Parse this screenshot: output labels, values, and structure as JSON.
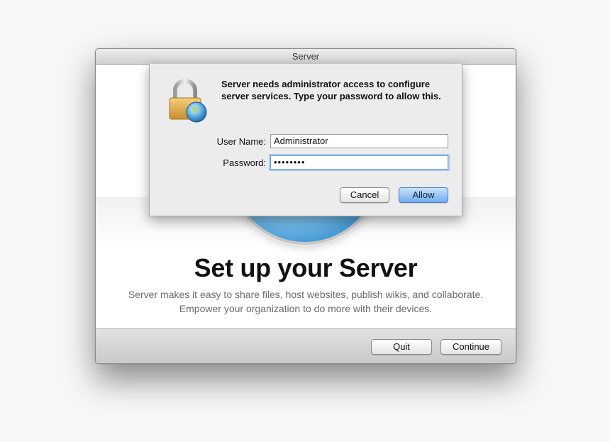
{
  "window": {
    "title": "Server"
  },
  "main": {
    "heading": "Set up your Server",
    "description_line1": "Server makes it easy to share files, host websites, publish wikis, and collaborate.",
    "description_line2": "Empower your organization to do more with their devices."
  },
  "footer": {
    "quit_label": "Quit",
    "continue_label": "Continue"
  },
  "auth_dialog": {
    "icon": "lock-globe-icon",
    "message": "Server needs administrator access to configure server services. Type your password to allow this.",
    "username_label": "User Name:",
    "username_value": "Administrator",
    "password_label": "Password:",
    "password_masked": "••••••••",
    "cancel_label": "Cancel",
    "allow_label": "Allow"
  },
  "colors": {
    "allow_button": "#6faaf0",
    "focus_ring": "#a9c9ef"
  }
}
